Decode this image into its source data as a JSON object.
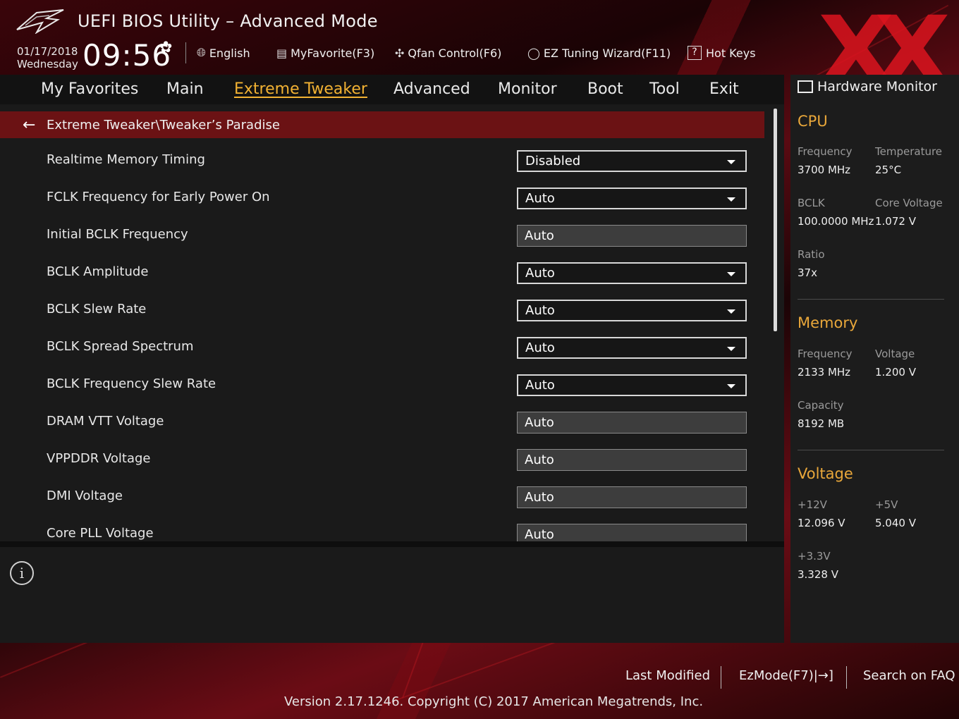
{
  "header": {
    "title": "UEFI BIOS Utility – Advanced Mode",
    "date": "01/17/2018",
    "weekday": "Wednesday",
    "time": "09:56",
    "language": "English",
    "favorite": "MyFavorite(F3)",
    "qfan": "Qfan Control(F6)",
    "ez_tuning": "EZ Tuning Wizard(F11)",
    "hot_keys": "Hot Keys",
    "hot_keys_glyph": "?"
  },
  "menu": {
    "items": [
      "My Favorites",
      "Main",
      "Extreme Tweaker",
      "Advanced",
      "Monitor",
      "Boot",
      "Tool",
      "Exit"
    ],
    "active": "Extreme Tweaker"
  },
  "breadcrumb": "Extreme Tweaker\\Tweaker’s Paradise",
  "settings": [
    {
      "label": "Realtime Memory Timing",
      "value": "Disabled",
      "type": "dropdown"
    },
    {
      "label": "FCLK Frequency for Early Power On",
      "value": "Auto",
      "type": "dropdown"
    },
    {
      "label": "Initial BCLK Frequency",
      "value": "Auto",
      "type": "field"
    },
    {
      "label": "BCLK Amplitude",
      "value": "Auto",
      "type": "dropdown"
    },
    {
      "label": "BCLK Slew Rate",
      "value": "Auto",
      "type": "dropdown"
    },
    {
      "label": "BCLK Spread Spectrum",
      "value": "Auto",
      "type": "dropdown"
    },
    {
      "label": "BCLK Frequency Slew Rate",
      "value": "Auto",
      "type": "dropdown"
    },
    {
      "label": "DRAM VTT Voltage",
      "value": "Auto",
      "type": "field"
    },
    {
      "label": "VPPDDR Voltage",
      "value": "Auto",
      "type": "field"
    },
    {
      "label": "DMI Voltage",
      "value": "Auto",
      "type": "field"
    },
    {
      "label": "Core PLL Voltage",
      "value": "Auto",
      "type": "field"
    }
  ],
  "info_glyph": "i",
  "hardware_monitor": {
    "title": "Hardware Monitor",
    "cpu": {
      "heading": "CPU",
      "frequency_label": "Frequency",
      "frequency": "3700 MHz",
      "temperature_label": "Temperature",
      "temperature": "25°C",
      "bclk_label": "BCLK",
      "bclk": "100.0000 MHz",
      "core_voltage_label": "Core Voltage",
      "core_voltage": "1.072 V",
      "ratio_label": "Ratio",
      "ratio": "37x"
    },
    "memory": {
      "heading": "Memory",
      "frequency_label": "Frequency",
      "frequency": "2133 MHz",
      "voltage_label": "Voltage",
      "voltage": "1.200 V",
      "capacity_label": "Capacity",
      "capacity": "8192 MB"
    },
    "voltage": {
      "heading": "Voltage",
      "v12_label": "+12V",
      "v12": "12.096 V",
      "v5_label": "+5V",
      "v5": "5.040 V",
      "v33_label": "+3.3V",
      "v33": "3.328 V"
    }
  },
  "footer": {
    "last_modified": "Last Modified",
    "ezmode": "EzMode(F7)|→]",
    "search_faq": "Search on FAQ",
    "version": "Version 2.17.1246. Copyright (C) 2017 American Megatrends, Inc."
  },
  "watermark": "XX",
  "colors": {
    "accent": "#f2b233",
    "section": "#e9a73a",
    "breadcrumb_bg": "#6b1214"
  }
}
